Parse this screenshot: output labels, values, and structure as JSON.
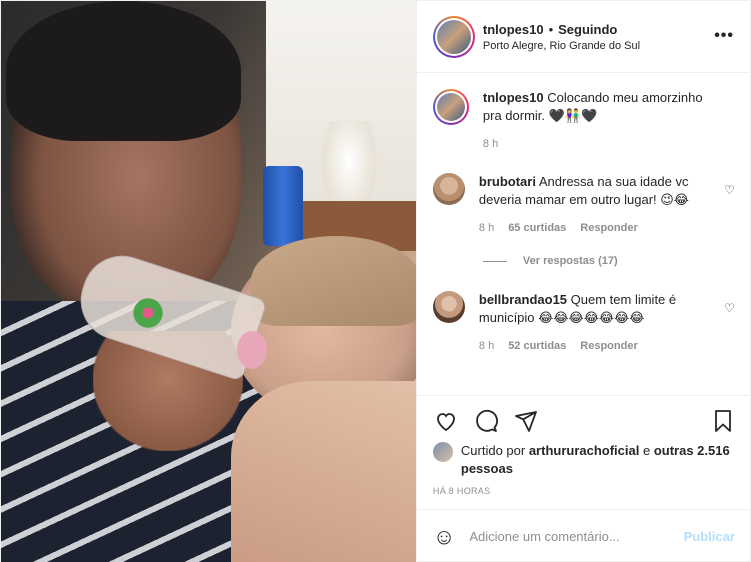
{
  "post": {
    "username": "tnlopes10",
    "dot": "•",
    "follow_status": "Seguindo",
    "location": "Porto Alegre, Rio Grande do Sul",
    "more_icon": "more-horizontal-icon"
  },
  "caption": {
    "username": "tnlopes10",
    "text": "Colocando meu amorzinho pra dormir. 🖤👫🖤",
    "time": "8 h"
  },
  "comments": [
    {
      "username": "brubotari",
      "text": "Andressa na sua idade vc deveria mamar em outro lugar! 😉😂",
      "time": "8 h",
      "likes": "65 curtidas",
      "reply": "Responder",
      "view_replies": "Ver respostas (17)"
    },
    {
      "username": "bellbrandao15",
      "text": "Quem tem limite é município 😂😂😂😂😂😂😂",
      "time": "8 h",
      "likes": "52 curtidas",
      "reply": "Responder"
    }
  ],
  "likes": {
    "prefix": "Curtido por",
    "user": "arthururachoficial",
    "and": "e",
    "others": "outras 2.516 pessoas"
  },
  "timestamp": "HÁ 8 HORAS",
  "add_comment": {
    "placeholder": "Adicione um comentário...",
    "publish": "Publicar",
    "emoji": "☺"
  },
  "icons": [
    "heart-icon",
    "comment-icon",
    "share-icon",
    "bookmark-icon"
  ],
  "colors": {
    "accent": "#b2dffc",
    "muted": "#8e8e8e",
    "text": "#262626"
  }
}
